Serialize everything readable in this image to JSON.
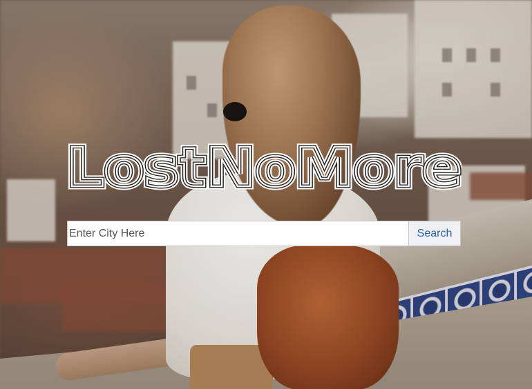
{
  "hero": {
    "title": "LostNoMore",
    "background_image": "woman-overlooking-city-rooftops-photo"
  },
  "search": {
    "placeholder": "Enter City Here",
    "value": "",
    "button_label": "Search"
  },
  "colors": {
    "title_stroke": "#ffffff",
    "button_text": "#2c5fa8",
    "button_bg": "#eef0f4",
    "input_bg": "#ffffff"
  }
}
